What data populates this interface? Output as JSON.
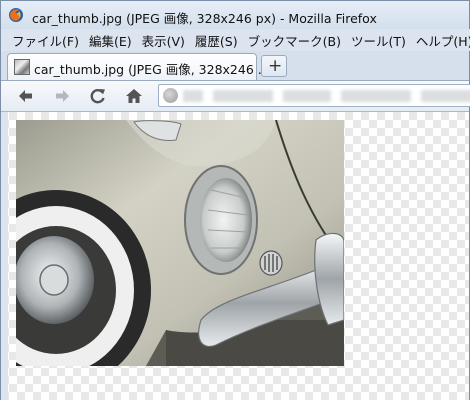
{
  "window": {
    "title": "car_thumb.jpg (JPEG 画像, 328x246 px) - Mozilla Firefox"
  },
  "menu": [
    {
      "label": "ファイル(F)"
    },
    {
      "label": "編集(E)"
    },
    {
      "label": "表示(V)"
    },
    {
      "label": "履歴(S)"
    },
    {
      "label": "ブックマーク(B)"
    },
    {
      "label": "ツール(T)"
    },
    {
      "label": "ヘルプ(H)"
    }
  ],
  "tab": {
    "label": "car_thumb.jpg (JPEG 画像, 328x246 ...",
    "newtab_symbol": "+"
  },
  "nav": {
    "back_icon": "back-arrow-icon",
    "forward_icon": "forward-arrow-icon",
    "reload_icon": "reload-icon",
    "home_icon": "home-icon",
    "url": ""
  },
  "content": {
    "image_name": "car_thumb.jpg",
    "image_colors": {
      "body": "#c8c7b8",
      "chrome": "#dfe3e6",
      "tire_wall": "#f2f2f2",
      "tire_dark": "#2c2c2c",
      "shadow": "#6f6e64"
    }
  }
}
